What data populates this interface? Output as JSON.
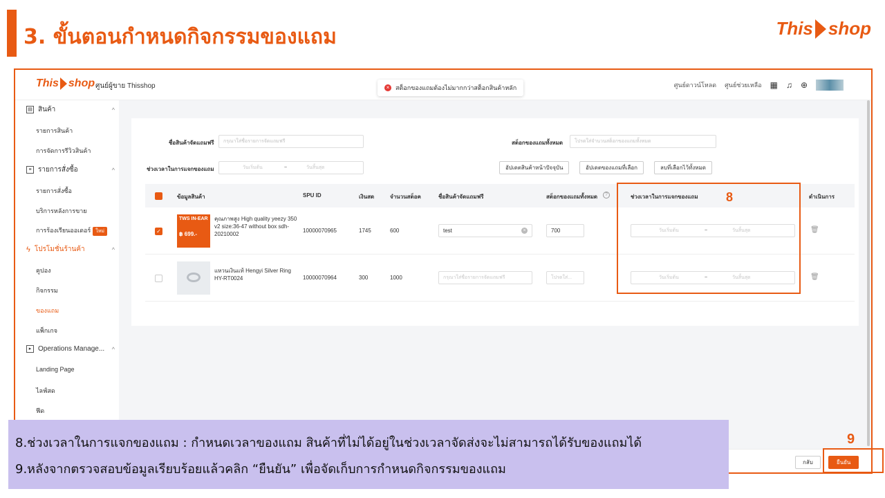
{
  "slide": {
    "title": "3. ขั้นตอนกำหนดกิจกรรมของแถม",
    "brand_this": "This",
    "brand_shop": "shop"
  },
  "app": {
    "logo_this": "This",
    "logo_shop": "shop",
    "seller_center": "ศูนย์ผู้ขาย Thisshop",
    "toast": "สต็อกของแถมต้องไม่มากกว่าสต็อกสินค้าหลัก",
    "top_links": [
      "ศูนย์ดาวน์โหลด",
      "ศูนย์ช่วยเหลือ"
    ]
  },
  "sidebar": {
    "groups": [
      {
        "label": "สินค้า",
        "items": [
          "รายการสินค้า",
          "การจัดการรีวิวสินค้า"
        ]
      },
      {
        "label": "รายการสั่งซื้อ",
        "items": [
          "รายการสั่งซื้อ",
          "บริการหลังการขาย",
          "การร้องเรียนออเดอร์"
        ]
      },
      {
        "label": "โปรโมชั่นร้านค้า",
        "items": [
          "คูปอง",
          "กิจกรรม",
          "ของแถม",
          "แพ็กเกจ"
        ]
      },
      {
        "label": "Operations Manage...",
        "items": [
          "Landing Page",
          "ไลฟ์สด",
          "ฟีด"
        ]
      }
    ],
    "new_badge": "ใหม่"
  },
  "filters": {
    "gift_name_label": "ชื่อสินค้าจัดแถมฟรี",
    "gift_name_placeholder": "กรุณาใส่ชื่อรายการจัดแถมฟรี",
    "gift_stock_label": "สต็อกของแถมทั้งหมด",
    "gift_stock_placeholder": "โปรดใส่จำนวนสต็อกของแถมทั้งหมด",
    "period_label": "ช่วงเวลาในการแจกของแถม",
    "start_placeholder": "วันเริ่มต้น",
    "range_sep": "~",
    "end_placeholder": "วันสิ้นสุด",
    "btn_update_current": "อัปเดตสินค้าหน้าปัจจุบัน",
    "btn_update_selected": "อัปเดตของแถมที่เลือก",
    "btn_delete_selected": "ลบที่เลือกไว้ทั้งหมด"
  },
  "table": {
    "headers": [
      "ข้อมูลสินค้า",
      "SPU ID",
      "เงินสด",
      "จำนวนสต็อค",
      "ชื่อสินค้าจัดแถมฟรี",
      "สต็อกของแถมทั้งหมด",
      "ช่วงเวลาในการแจกของแถม",
      "ดำเนินการ"
    ],
    "rows": [
      {
        "name": "คุณภาพสูง High quality yeezy 350 v2 size:36-47 without box sdh-20210002",
        "thumb_title": "TWS IN-EAR",
        "thumb_price": "฿ 699.-",
        "spu": "10000070965",
        "cash": "1745",
        "stock": "600",
        "gift_name": "test",
        "gift_stock": "700",
        "checked": true
      },
      {
        "name": "แหวนเงินแท้ Hengyi Silver Ring HY-RT0024",
        "spu": "10000070964",
        "cash": "300",
        "stock": "1000",
        "gift_name_placeholder": "กรุณาใส่ชื่อรายการจัดแถมฟรี",
        "gift_stock_placeholder": "โปรดใส่...",
        "checked": false
      }
    ]
  },
  "footer": {
    "back": "กลับ",
    "confirm": "ยืนยัน"
  },
  "callouts": {
    "num8": "8",
    "num9": "9"
  },
  "notes": {
    "line8": "8.ช่วงเวลาในการแจกของแถม :  กำหนดเวลาของแถม สินค้าที่ไม่ได้อยู่ในช่วงเวลาจัดส่งจะไม่สามารถได้รับของแถมได้",
    "line9": "9.หลังจากตรวจสอบข้อมูลเรียบร้อยแล้วคลิก “ยืนยัน” เพื่อจัดเก็บการกำหนดกิจกรรมของแถม"
  },
  "colors": {
    "accent": "#e85a13",
    "note_bg": "#c9c0ee"
  }
}
